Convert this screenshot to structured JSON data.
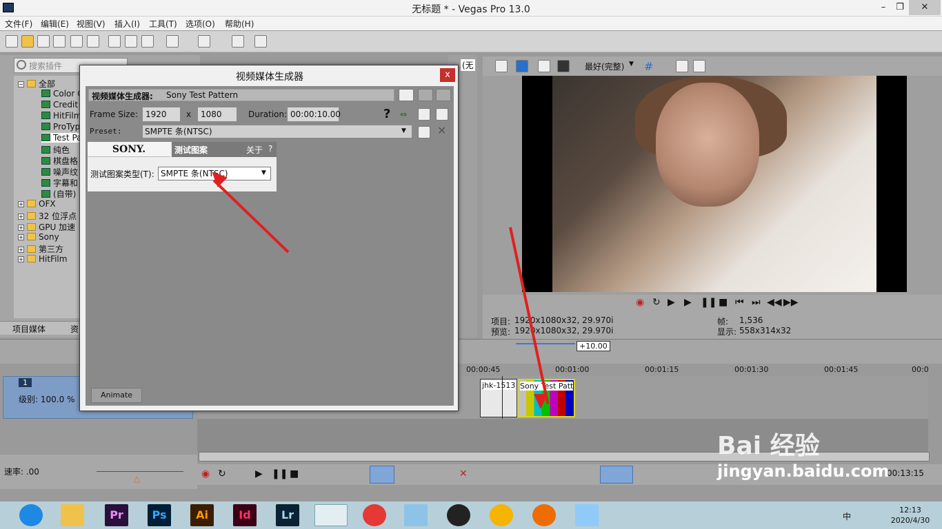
{
  "window": {
    "title": "无标题 * - Vegas Pro 13.0",
    "min": "–",
    "max": "❐",
    "close": "✕"
  },
  "menu": [
    "文件(F)",
    "编辑(E)",
    "视图(V)",
    "插入(I)",
    "工具(T)",
    "选项(O)",
    "帮助(H)"
  ],
  "plugin_browser": {
    "search_placeholder": "搜索插件",
    "tree": [
      {
        "label": "全部",
        "type": "folder",
        "expanded": true
      },
      {
        "label": "Color C",
        "type": "plugin"
      },
      {
        "label": "Credit",
        "type": "plugin"
      },
      {
        "label": "HitFilm",
        "type": "plugin"
      },
      {
        "label": "ProTyp",
        "type": "plugin"
      },
      {
        "label": "Test Pa",
        "type": "plugin",
        "selected": true
      },
      {
        "label": "纯色",
        "type": "plugin"
      },
      {
        "label": "棋盘格",
        "type": "plugin"
      },
      {
        "label": "噪声纹",
        "type": "plugin"
      },
      {
        "label": "字幕和",
        "type": "plugin"
      },
      {
        "label": "(自带)",
        "type": "plugin"
      },
      {
        "label": "OFX",
        "type": "folder"
      },
      {
        "label": "32 位浮点",
        "type": "folder"
      },
      {
        "label": "GPU 加速",
        "type": "folder"
      },
      {
        "label": "Sony",
        "type": "folder"
      },
      {
        "label": "第三方",
        "type": "folder"
      },
      {
        "label": "HitFilm",
        "type": "folder"
      }
    ],
    "tabs": [
      "项目媒体",
      "资"
    ]
  },
  "mid_tab": "(无",
  "preview": {
    "quality": "最好(完整)",
    "project_label": "项目:",
    "project_value": "1920x1080x32, 29.970i",
    "preview_label": "预览:",
    "preview_value": "1920x1080x32, 29.970i",
    "frame_label": "帧:",
    "frame_value": "1,536",
    "display_label": "显示:",
    "display_value": "558x314x32"
  },
  "dialog": {
    "title": "视频媒体生成器",
    "close": "x",
    "generator_label": "视频媒体生成器:",
    "generator_name": "Sony Test Pattern",
    "frame_size_label": "Frame Size:",
    "width": "1920",
    "x_label": "x",
    "height": "1080",
    "duration_label": "Duration:",
    "duration": "00:00:10.00",
    "help": "?",
    "preset_label": "Preset:",
    "preset_value": "SMPTE 条(NTSC)",
    "plugin": {
      "brand": "SONY.",
      "header": "测试图案",
      "about": "关于",
      "about_q": "?",
      "type_label": "测试图案类型(T):",
      "type_value": "SMPTE 条(NTSC)"
    },
    "animate": "Animate"
  },
  "timeline": {
    "offset_badge": "+10.00",
    "ruler": [
      "00:00:45",
      "00:01:00",
      "00:01:15",
      "00:01:30",
      "00:01:45",
      "00:0"
    ],
    "track_number": "1",
    "track_level": "级别: 100.0 %",
    "clips": [
      {
        "label": "jhk-1513"
      },
      {
        "label": "Sony Test Patt"
      }
    ],
    "rate_label": "速率: .00",
    "right_time": "00:13:15"
  },
  "taskbar": {
    "apps": [
      "Pr",
      "Ps",
      "Ai",
      "Id",
      "Lr"
    ],
    "time": "12:13",
    "date": "2020/4/30",
    "ime": "中"
  },
  "watermark": {
    "main": "Bai 经验",
    "sub": "jingyan.baidu.com"
  },
  "colors": {
    "accent_red": "#e02020",
    "track_blue": "#7d9cc6",
    "pr": "#2a0f3a",
    "ps": "#001e36",
    "ai": "#3b1d00",
    "id": "#3b0015",
    "lr": "#0a2234"
  }
}
